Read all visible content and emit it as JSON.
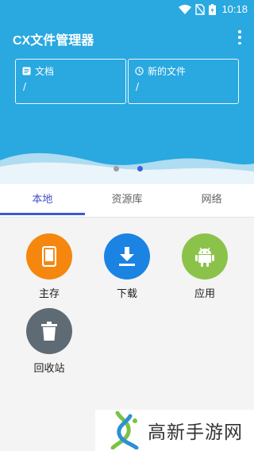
{
  "status_bar": {
    "time": "10:18"
  },
  "app": {
    "title": "CX文件管理器"
  },
  "header_cards": [
    {
      "title": "文档",
      "path": "/",
      "icon": "document-icon"
    },
    {
      "title": "新的文件",
      "path": "/",
      "icon": "clock-icon"
    }
  ],
  "tabs": [
    {
      "label": "本地",
      "active": true
    },
    {
      "label": "资源库",
      "active": false
    },
    {
      "label": "网络",
      "active": false
    }
  ],
  "storage_items": [
    {
      "label": "主存",
      "icon": "phone-icon",
      "color": "#f5870f"
    },
    {
      "label": "下载",
      "icon": "download-icon",
      "color": "#1b84e3"
    },
    {
      "label": "应用",
      "icon": "android-icon",
      "color": "#8bc34a"
    },
    {
      "label": "回收站",
      "icon": "trash-icon",
      "color": "#5f6b74"
    }
  ],
  "watermark": {
    "text": "高新手游网"
  },
  "colors": {
    "header": "#2aa8e0",
    "accent": "#3d5bd6"
  }
}
